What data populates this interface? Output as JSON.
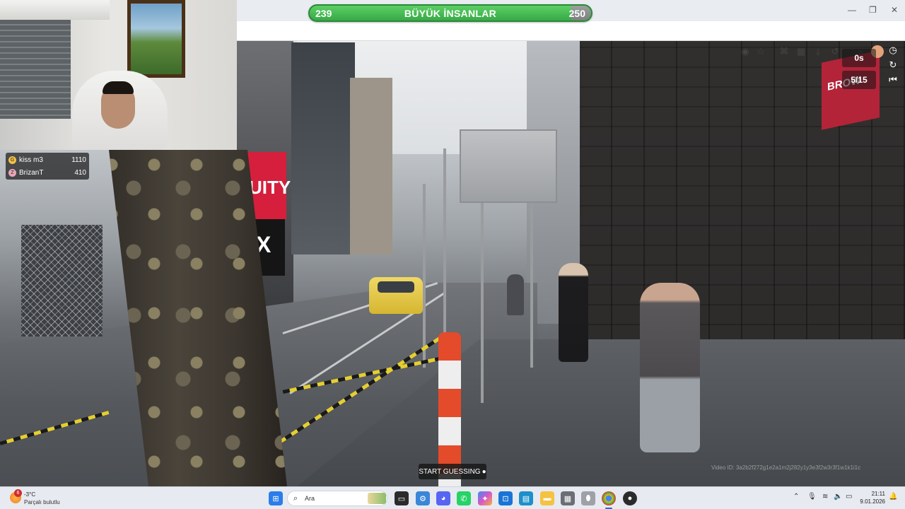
{
  "game": {
    "banner_left": "239",
    "banner_title": "BÜYÜK İNSANLAR",
    "banner_right": "250",
    "timer": "0s",
    "round": "5/15",
    "start_button": "START GUESSING",
    "video_id": "Video ID: 3a2b2f272g1e2a1m2j282y1y3e3f2w3r3f1w1k1i1c",
    "street_sign_red": "UITY",
    "street_sign_black": "X",
    "street_sign_brown": "BROW"
  },
  "leaderboard": [
    {
      "name": "kiss m3",
      "score": "1110",
      "badge_color": "#f3c245"
    },
    {
      "name": "BrizanT",
      "score": "410",
      "badge_color": "#e8a7b8"
    }
  ],
  "taskbar": {
    "weather_badge": "6",
    "weather_temp": "-3°C",
    "weather_condition": "Parçalı bulutlu",
    "search_placeholder": "Ara",
    "time": "21:11",
    "date": "9.01.2026"
  },
  "icons": {
    "browser_toolbar": [
      "eye-off-icon",
      "star-icon",
      "translate-icon",
      "apps-icon",
      "download-icon",
      "history-icon",
      "playlist-icon",
      "profile-icon",
      "more-icon"
    ],
    "game": [
      "clock-icon",
      "refresh-icon",
      "skip-back-icon",
      "location-pin-icon"
    ],
    "taskbar": [
      "windows-start-icon",
      "search-icon",
      "file-explorer-icon",
      "settings-icon",
      "discord-icon",
      "whatsapp-icon",
      "copilot-icon",
      "store-icon",
      "photos-icon",
      "folder-icon",
      "calculator-icon",
      "mouse-icon",
      "chrome-icon",
      "obs-icon"
    ]
  },
  "colors": {
    "banner_green": "#3fb24c",
    "taskbar_bg": "#e7eaf0",
    "accent_blue": "#2a6ad1"
  }
}
